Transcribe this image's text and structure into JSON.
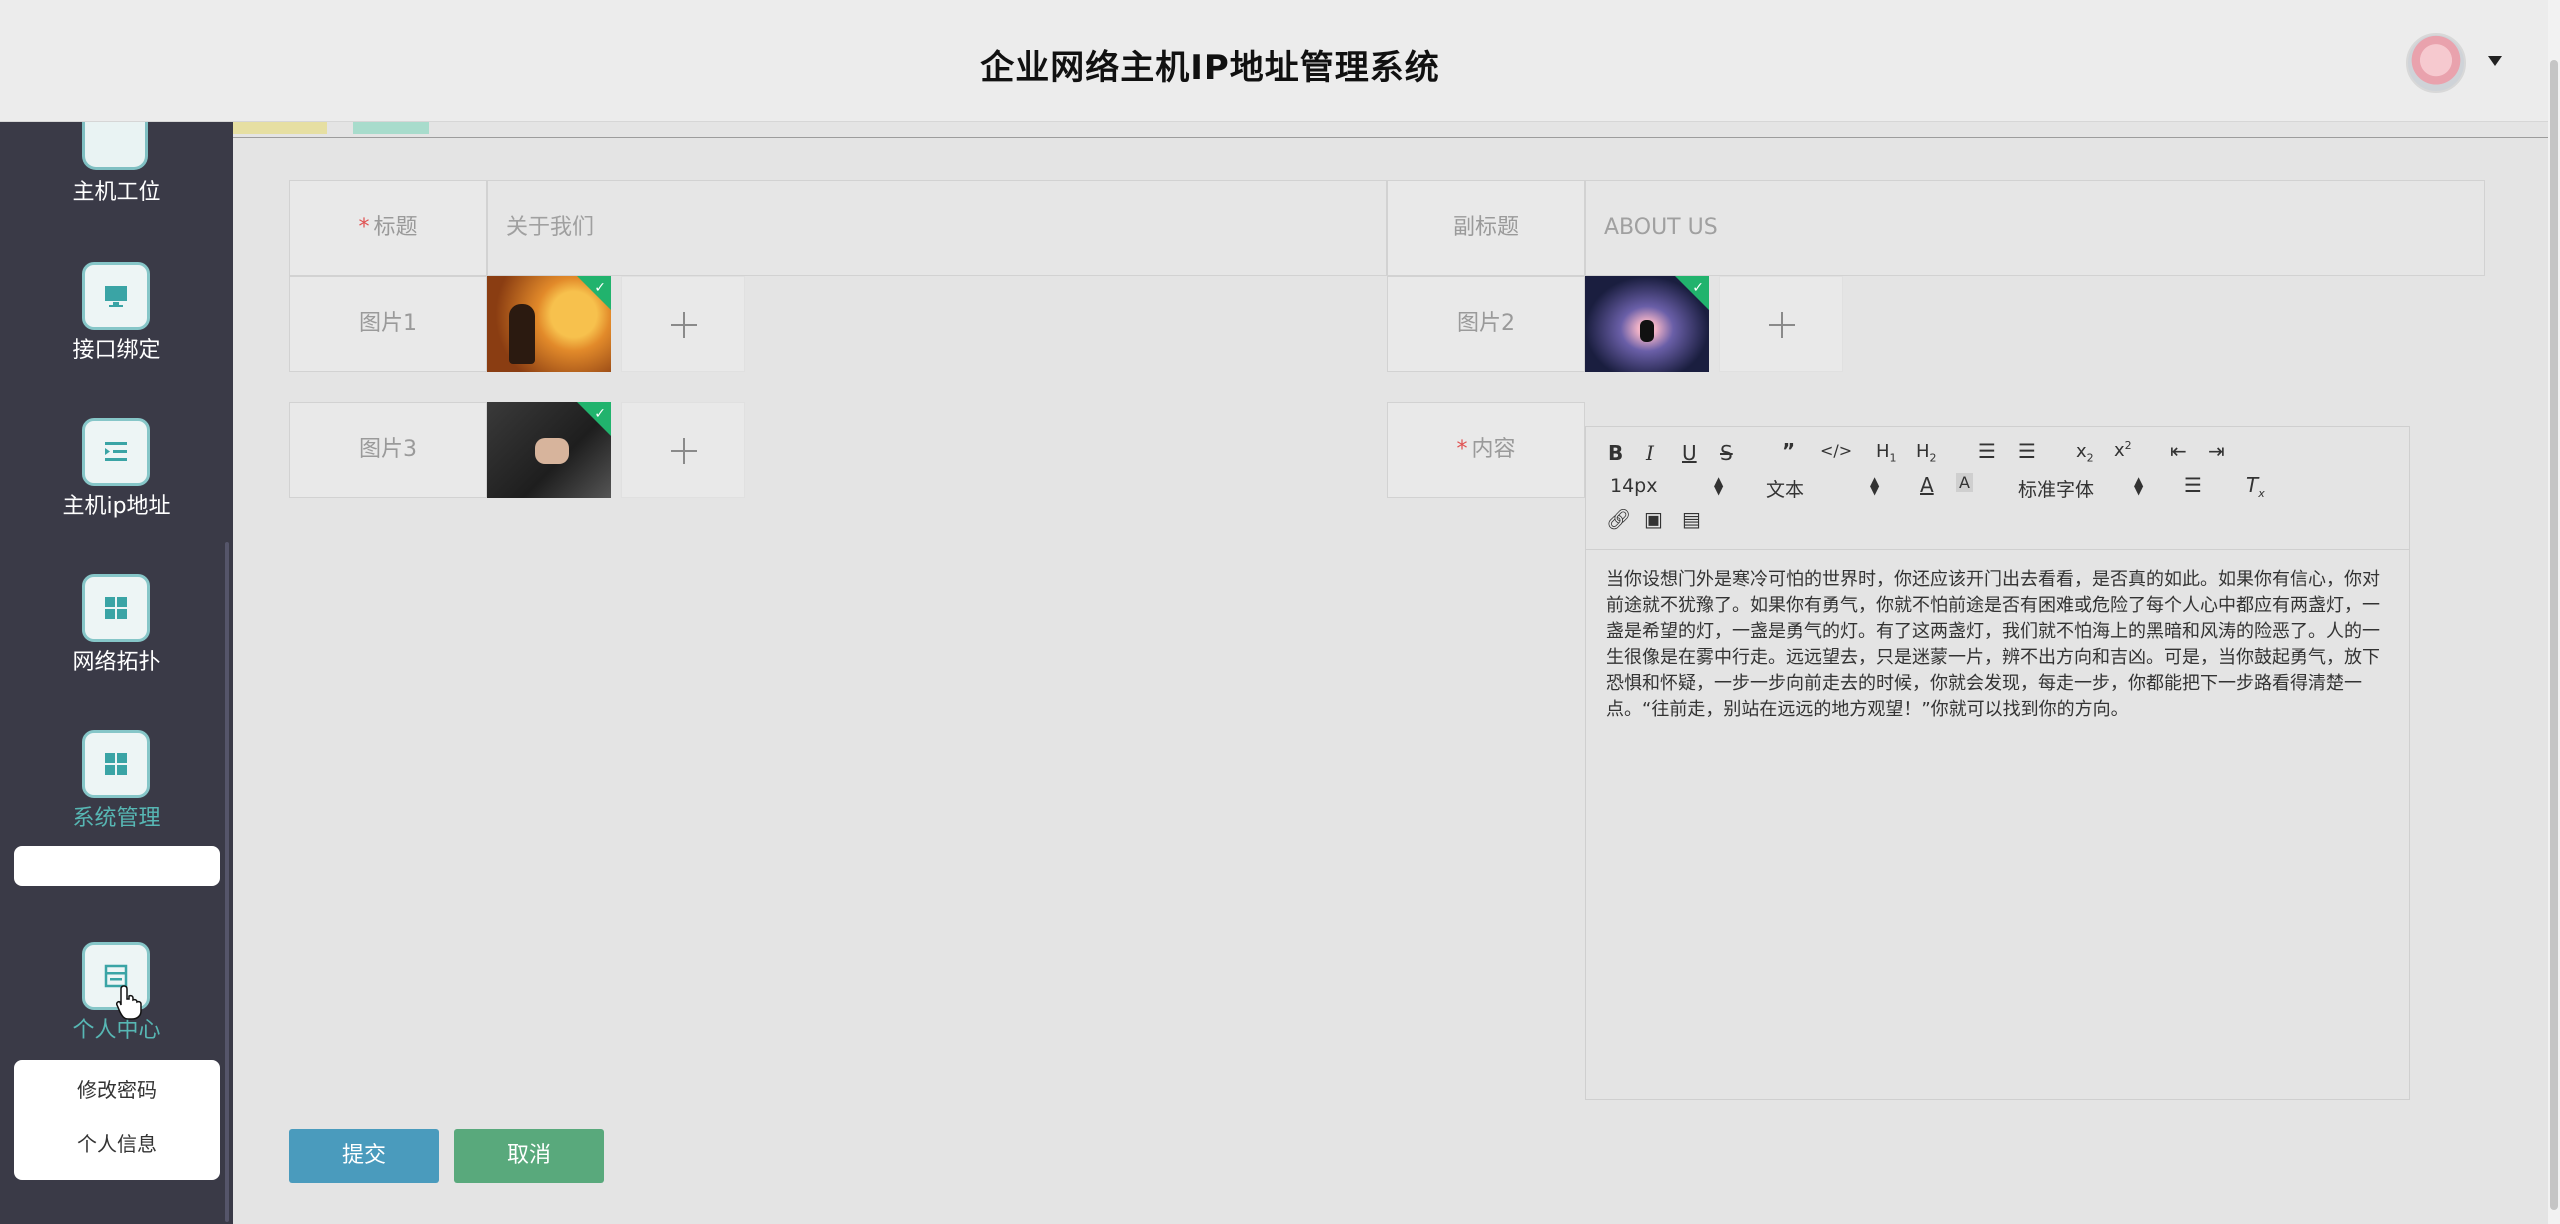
{
  "header": {
    "title": "企业网络主机IP地址管理系统"
  },
  "sidebar": {
    "items": [
      {
        "label": "主机工位",
        "icon": "desk-icon"
      },
      {
        "label": "接口绑定",
        "icon": "monitor-icon"
      },
      {
        "label": "主机ip地址",
        "icon": "list-indent-icon"
      },
      {
        "label": "网络拓扑",
        "icon": "grid-icon"
      },
      {
        "label": "系统管理",
        "icon": "grid-icon",
        "active": true
      },
      {
        "label": "个人中心",
        "icon": "window-icon",
        "active": true
      }
    ],
    "submenu": [
      {
        "label": "修改密码"
      },
      {
        "label": "个人信息"
      }
    ]
  },
  "form": {
    "title_label": "标题",
    "title_value": "关于我们",
    "subtitle_label": "副标题",
    "subtitle_value": "ABOUT US",
    "image1_label": "图片1",
    "image2_label": "图片2",
    "image3_label": "图片3",
    "content_label": "内容",
    "required_mark": "*"
  },
  "editor": {
    "font_size": "14px",
    "text_type": "文本",
    "font_family": "标准字体",
    "content": "当你设想门外是寒冷可怕的世界时，你还应该开门出去看看，是否真的如此。如果你有信心，你对前途就不犹豫了。如果你有勇气，你就不怕前途是否有困难或危险了每个人心中都应有两盏灯，一盏是希望的灯，一盏是勇气的灯。有了这两盏灯，我们就不怕海上的黑暗和风涛的险恶了。人的一生很像是在雾中行走。远远望去，只是迷蒙一片，辨不出方向和吉凶。可是，当你鼓起勇气，放下恐惧和怀疑，一步一步向前走去的时候，你就会发现，每走一步，你都能把下一步路看得清楚一点。“往前走，别站在远远的地方观望！”你就可以找到你的方向。"
  },
  "buttons": {
    "submit": "提交",
    "cancel": "取消"
  },
  "colors": {
    "sidebar_bg": "#3a3a47",
    "accent_teal": "#57b7b4",
    "submit": "#4a9bbd",
    "cancel": "#59a97c",
    "check_green": "#21b36d"
  }
}
